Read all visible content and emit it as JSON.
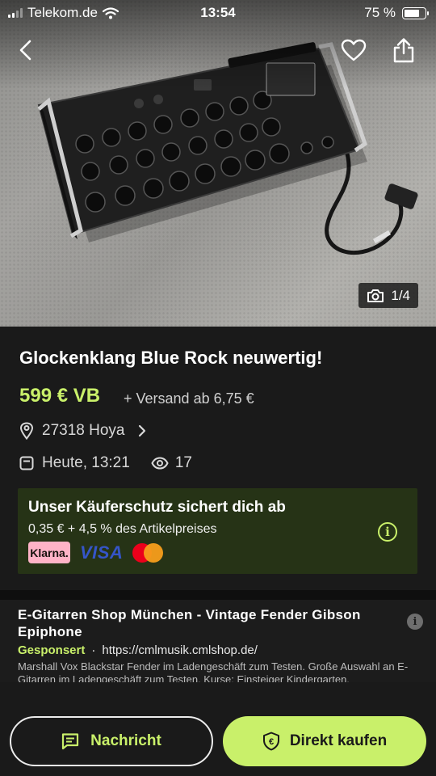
{
  "status_bar": {
    "carrier": "Telekom.de",
    "time": "13:54",
    "battery": "75 %"
  },
  "image_gallery": {
    "counter": "1/4"
  },
  "listing": {
    "title": "Glockenklang Blue Rock neuwertig!",
    "price": "599 € VB",
    "shipping": "+ Versand ab 6,75 €",
    "location": "27318 Hoya",
    "date": "Heute, 13:21",
    "views": "17"
  },
  "buyer_protection": {
    "title": "Unser Käuferschutz sichert dich ab",
    "fee": "0,35 € + 4,5 % des Artikelpreises",
    "payment_methods": [
      "Klarna.",
      "VISA",
      "mastercard"
    ]
  },
  "sponsored_ad": {
    "title": "E-Gitarren Shop München - Vintage Fender Gibson Epiphone",
    "label": "Gesponsert",
    "separator": "·",
    "url": "https://cmlmusik.cmlshop.de/",
    "description": "Marshall Vox Blackstar Fender im Ladengeschäft zum Testen. Große Auswahl an E-Gitarren im Ladengeschäft zum Testen. Kurse: Einsteiger Kindergarten,"
  },
  "actions": {
    "message_label": "Nachricht",
    "buy_label": "Direkt kaufen"
  },
  "colors": {
    "accent": "#c9f06a",
    "background": "#1a1a1a",
    "protection_bg": "#263316"
  }
}
